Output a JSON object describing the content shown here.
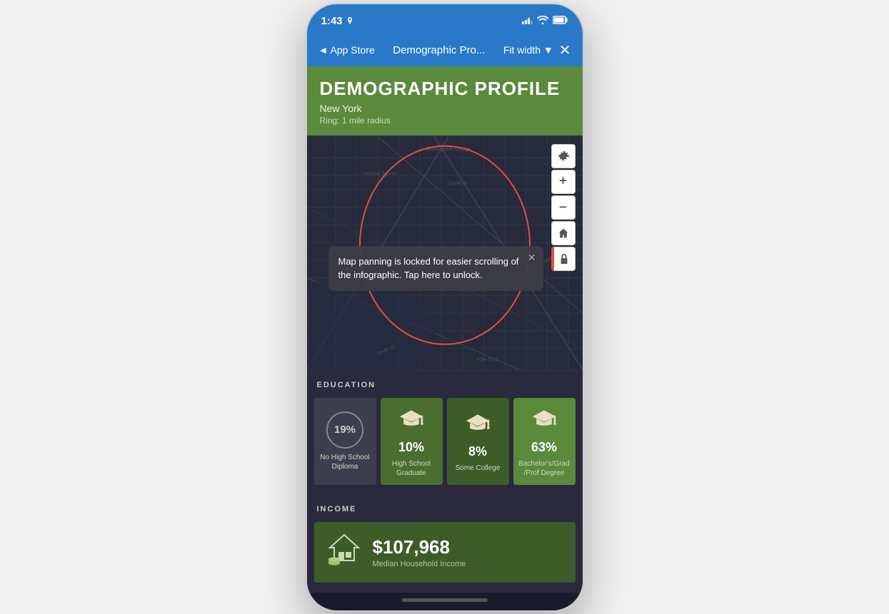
{
  "statusBar": {
    "time": "1:43",
    "timeIcon": "location-icon"
  },
  "navBar": {
    "backLabel": "◄ App Store",
    "title": "Demographic Pro...",
    "fitWidthLabel": "Fit width ▼",
    "closeLabel": "✕"
  },
  "header": {
    "title": "DEMOGRAPHIC PROFILE",
    "location": "New York",
    "ring": "Ring: 1 mile radius"
  },
  "map": {
    "tooltip": {
      "text": "Map panning is locked for easier scrolling of the infographic. Tap here to unlock.",
      "closeLabel": "✕"
    },
    "label1": "Greenwich Village",
    "label2": "Holland Tunnel"
  },
  "education": {
    "sectionTitle": "EDUCATION",
    "items": [
      {
        "percent": "19%",
        "label": "No High School Diploma",
        "type": "circle"
      },
      {
        "percent": "10%",
        "label": "High School Graduate",
        "type": "icon"
      },
      {
        "percent": "8%",
        "label": "Some College",
        "type": "icon"
      },
      {
        "percent": "63%",
        "label": "Bachelor's/Grad /Prof Degree",
        "type": "icon"
      }
    ]
  },
  "income": {
    "sectionTitle": "INCOME",
    "value": "$107,968",
    "label": "Median Household Income"
  }
}
